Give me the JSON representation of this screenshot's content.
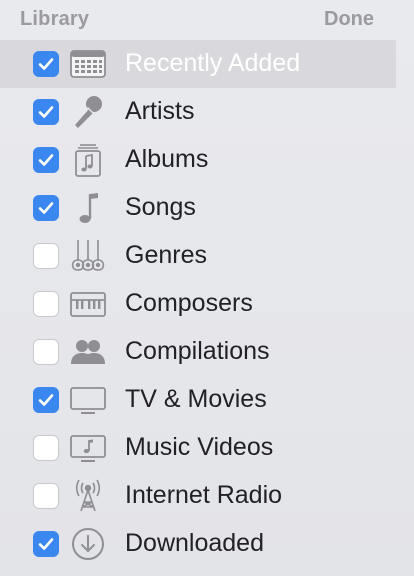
{
  "header": {
    "title": "Library",
    "done_label": "Done"
  },
  "items": [
    {
      "label": "Recently Added",
      "checked": true,
      "icon": "calendar-grid-icon",
      "highlighted": true
    },
    {
      "label": "Artists",
      "checked": true,
      "icon": "microphone-icon"
    },
    {
      "label": "Albums",
      "checked": true,
      "icon": "album-stack-icon"
    },
    {
      "label": "Songs",
      "checked": true,
      "icon": "music-note-icon"
    },
    {
      "label": "Genres",
      "checked": false,
      "icon": "guitars-icon"
    },
    {
      "label": "Composers",
      "checked": false,
      "icon": "piano-keys-icon"
    },
    {
      "label": "Compilations",
      "checked": false,
      "icon": "two-people-icon"
    },
    {
      "label": "TV & Movies",
      "checked": true,
      "icon": "tv-monitor-icon"
    },
    {
      "label": "Music Videos",
      "checked": false,
      "icon": "music-video-icon"
    },
    {
      "label": "Internet Radio",
      "checked": false,
      "icon": "radio-antenna-icon"
    },
    {
      "label": "Downloaded",
      "checked": true,
      "icon": "download-circle-icon"
    }
  ],
  "colors": {
    "accent": "#3a87f0",
    "highlight_row": "#d9d9dd",
    "icon_gray": "#8e8e93"
  }
}
